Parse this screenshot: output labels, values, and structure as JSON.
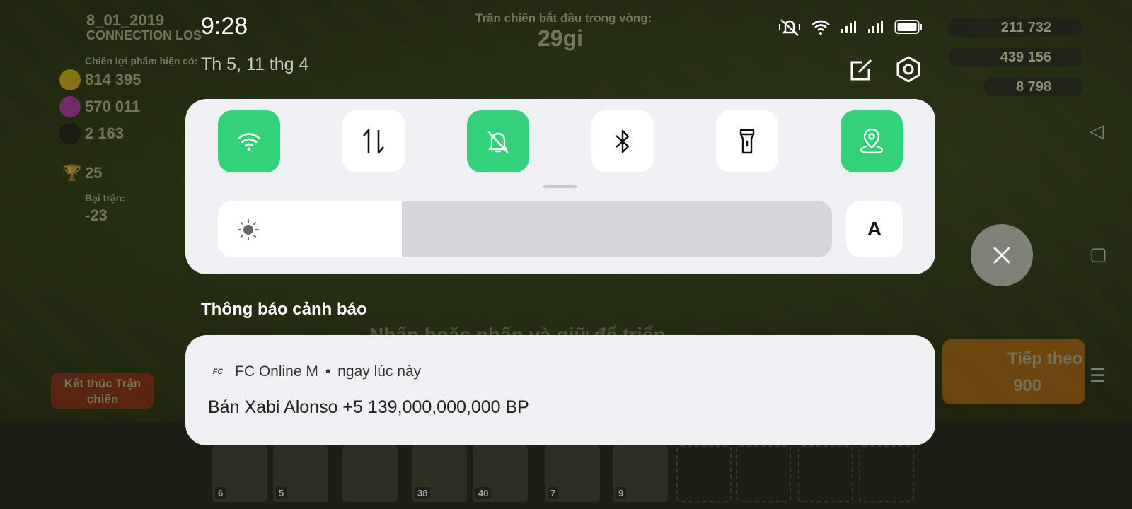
{
  "status_bar": {
    "time": "9:28",
    "date": "Th 5, 11 thg 4",
    "icons": [
      "mute-icon",
      "wifi-icon",
      "signal-icon",
      "signal-icon",
      "battery-icon"
    ]
  },
  "header_actions": {
    "edit_icon": "edit-icon",
    "settings_icon": "settings-icon"
  },
  "quick_settings": {
    "tiles": [
      {
        "name": "wifi",
        "icon": "wifi-icon",
        "active": true
      },
      {
        "name": "mobile-data",
        "icon": "data-arrows-icon",
        "active": false
      },
      {
        "name": "silent",
        "icon": "bell-off-icon",
        "active": true
      },
      {
        "name": "bluetooth",
        "icon": "bluetooth-icon",
        "active": false
      },
      {
        "name": "flashlight",
        "icon": "flashlight-icon",
        "active": false
      },
      {
        "name": "location",
        "icon": "location-icon",
        "active": true
      }
    ],
    "brightness_level": 0.3,
    "auto_brightness_label": "A"
  },
  "notifications": {
    "section_title": "Thông báo cảnh báo",
    "items": [
      {
        "app_icon": "FC",
        "app_name": "FC Online M",
        "separator": "•",
        "time": "ngay lúc này",
        "message": "Bán Xabi Alonso +5 139,000,000,000 BP"
      }
    ]
  },
  "game_background": {
    "date_label": "8_01_2019",
    "connection": "CONNECTION LOS",
    "loot_label": "Chiến lợi phẩm hiện có:",
    "gold": "814 395",
    "elixir": "570 011",
    "dark_elixir": "2 163",
    "trophies": "25",
    "defeat_label": "Bại trận:",
    "defeat_trophies": "-23",
    "battle_start_label": "Trận chiến bắt đầu trong vòng:",
    "battle_timer": "29gi",
    "my_gold": "211 732",
    "my_elixir": "439 156",
    "my_dark": "8 798",
    "end_battle": "Kết thúc Trận chiến",
    "next_label": "Tiếp theo",
    "next_cost": "900",
    "hint": "Nhấn hoặc nhấn và giữ để triển",
    "troops": [
      "6",
      "5",
      "",
      "38",
      "40",
      "7",
      "9"
    ]
  },
  "colors": {
    "accent_green": "#33d17a",
    "panel": "#eff0f3"
  }
}
